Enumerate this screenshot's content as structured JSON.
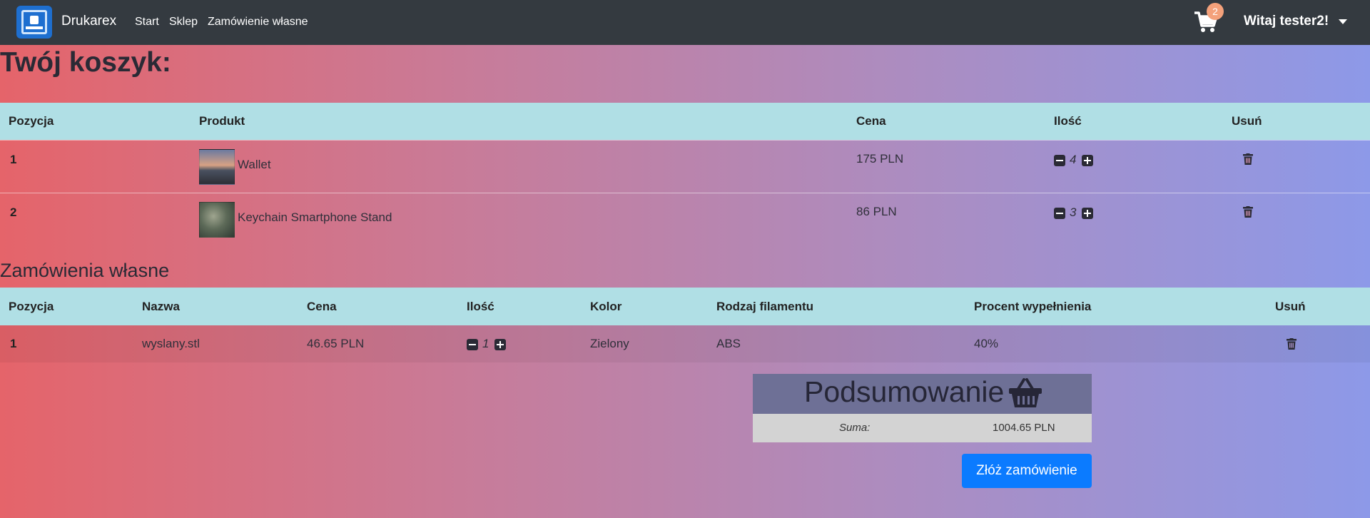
{
  "navbar": {
    "brand": "Drukarex",
    "links": [
      "Start",
      "Sklep",
      "Zamówienie własne"
    ],
    "cart_count": "2",
    "user_greeting": "Witaj tester2!"
  },
  "cart": {
    "title": "Twój koszyk:",
    "headers": [
      "Pozycja",
      "Produkt",
      "Cena",
      "Ilość",
      "Usuń"
    ],
    "rows": [
      {
        "position": "1",
        "product": "Wallet",
        "price": "175 PLN",
        "quantity": "4"
      },
      {
        "position": "2",
        "product": "Keychain Smartphone Stand",
        "price": "86 PLN",
        "quantity": "3"
      }
    ]
  },
  "custom_orders": {
    "title": "Zamówienia własne",
    "headers": [
      "Pozycja",
      "Nazwa",
      "Cena",
      "Ilość",
      "Kolor",
      "Rodzaj filamentu",
      "Procent wypełnienia",
      "Usuń"
    ],
    "rows": [
      {
        "position": "1",
        "name": "wyslany.stl",
        "price": "46.65 PLN",
        "quantity": "1",
        "color": "Zielony",
        "filament": "ABS",
        "fill": "40%"
      }
    ]
  },
  "summary": {
    "title": "Podsumowanie",
    "sum_label": "Suma:",
    "sum_value": "1004.65 PLN",
    "order_button": "Złóż zamówienie"
  },
  "colors": {
    "navbar": "#343a40",
    "table_header": "#b0dfe5",
    "primary_button": "#0b7bff",
    "cart_badge": "#f4a17b"
  },
  "icons": [
    "printer-logo-icon",
    "cart-icon",
    "caret-down-icon",
    "minus-square-icon",
    "plus-square-icon",
    "trash-icon",
    "basket-icon"
  ]
}
